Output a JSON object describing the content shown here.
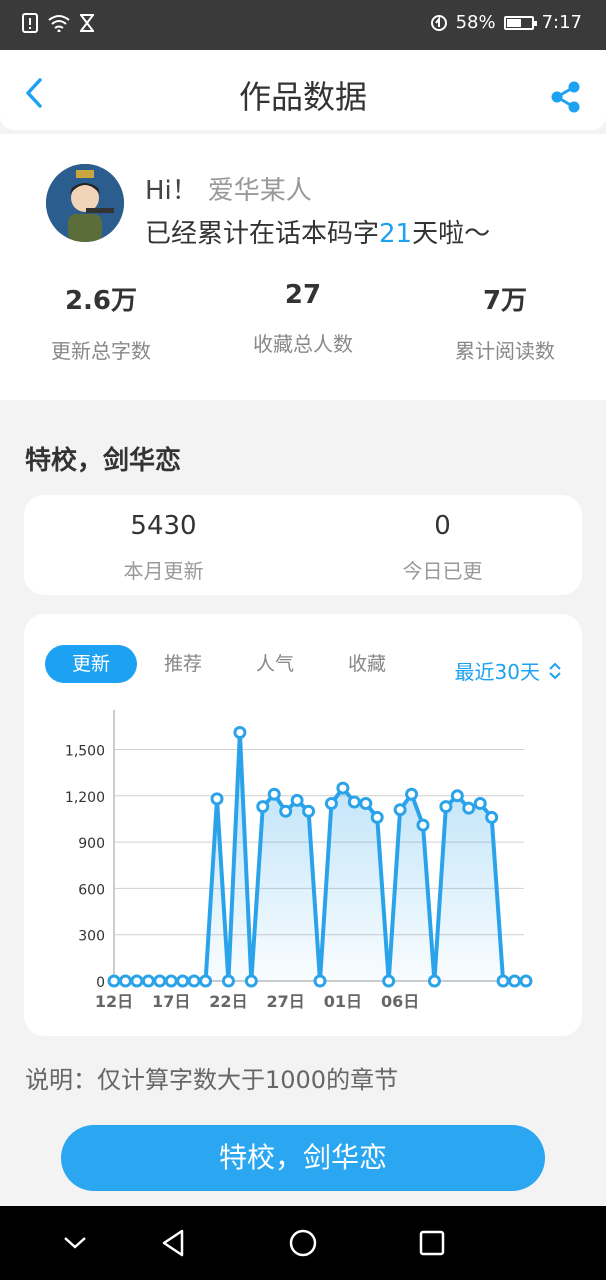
{
  "status_bar": {
    "battery_text": "58%",
    "battery_level": 0.58,
    "time": "7:17",
    "icons": [
      "notification-alert-icon",
      "wifi-icon",
      "hourglass-icon",
      "data-saver-icon",
      "battery-icon"
    ]
  },
  "header": {
    "title": "作品数据",
    "back_icon": "chevron-left-icon",
    "share_icon": "share-icon"
  },
  "profile": {
    "greeting": "Hi！",
    "username": "爱华某人",
    "days_prefix": "已经累计在话本码字",
    "days_count": "21",
    "days_suffix": "天啦～",
    "stats": [
      {
        "value": "2.6万",
        "label": "更新总字数"
      },
      {
        "value": "27",
        "label": "收藏总人数"
      },
      {
        "value": "7万",
        "label": "累计阅读数"
      }
    ]
  },
  "work": {
    "title": "特校，剑华恋",
    "month_updates": {
      "value": "5430",
      "label": "本月更新"
    },
    "today_updates": {
      "value": "0",
      "label": "今日已更"
    }
  },
  "chart_panel": {
    "tabs": [
      "更新",
      "推荐",
      "人气",
      "收藏"
    ],
    "active_tab": 0,
    "range_label": "最近30天"
  },
  "chart_data": {
    "type": "area",
    "x_tick_labels": [
      "12日",
      "17日",
      "22日",
      "27日",
      "01日",
      "06日"
    ],
    "y_tick_labels": [
      "0",
      "300",
      "600",
      "900",
      "1,200",
      "1,500"
    ],
    "ylim": [
      0,
      1650
    ],
    "grid": true,
    "color": "#2aa3ea",
    "values": [
      0,
      0,
      0,
      0,
      0,
      0,
      0,
      0,
      0,
      1180,
      0,
      1610,
      0,
      1130,
      1210,
      1100,
      1170,
      1100,
      0,
      1150,
      1250,
      1160,
      1150,
      1060,
      0,
      1110,
      1210,
      1010,
      0,
      1130,
      1200,
      1120,
      1150,
      1060,
      0,
      0,
      0
    ]
  },
  "note": "说明：仅计算字数大于1000的章节",
  "primary_button": "特校，剑华恋",
  "nav_bar": {
    "icons": [
      "collapse-chevron-icon",
      "back-triangle-icon",
      "home-circle-icon",
      "recents-square-icon"
    ]
  }
}
